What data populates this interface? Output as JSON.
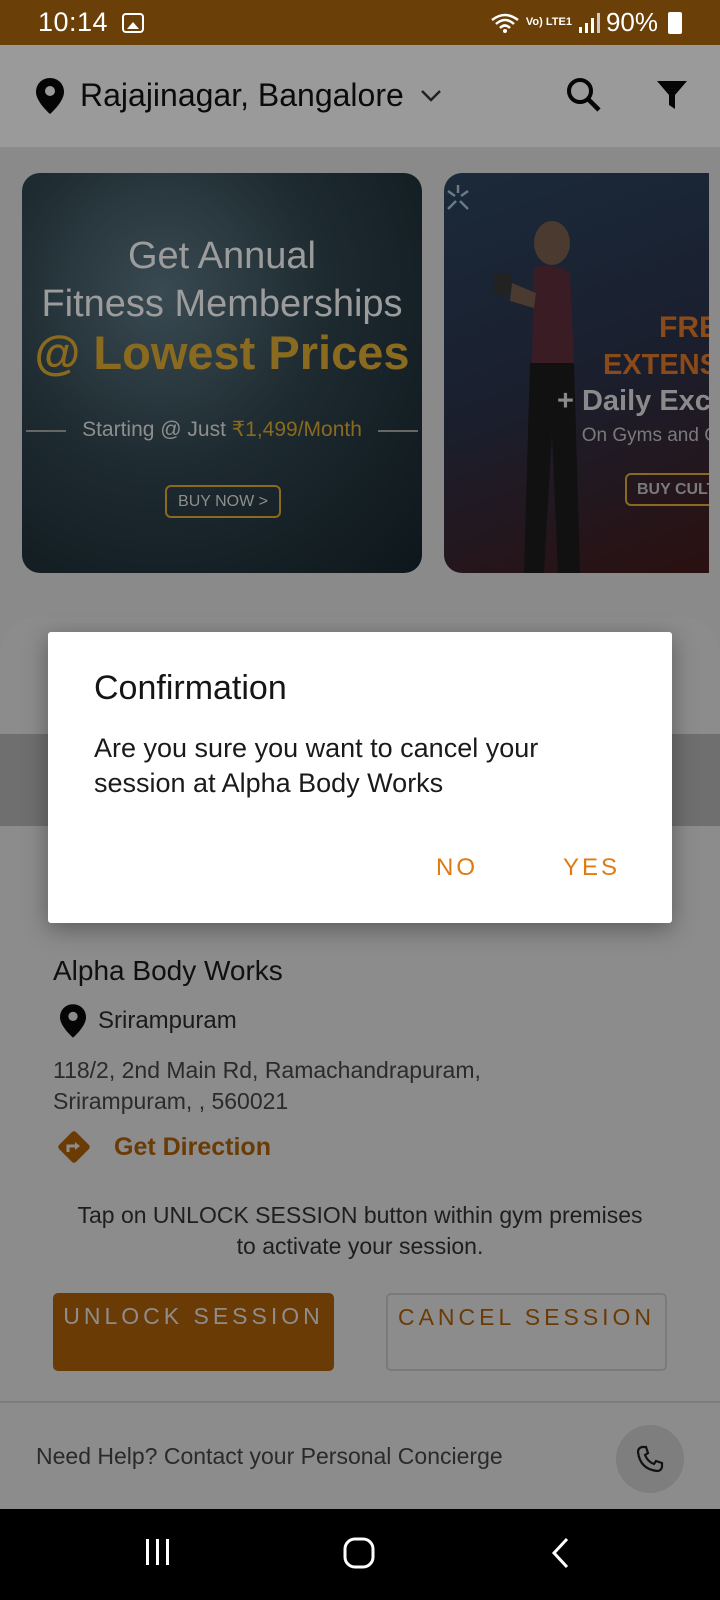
{
  "status_bar": {
    "time": "10:14",
    "network": "Vo) LTE1",
    "battery": "90%"
  },
  "header": {
    "location": "Rajajinagar, Bangalore"
  },
  "banners": [
    {
      "line1": "Get Annual",
      "line2": "Fitness Memberships",
      "line3": "@ Lowest Prices",
      "line4_prefix": "Starting @ Just ",
      "line4_price": "₹1,499/Month",
      "button": "BUY NOW >"
    },
    {
      "line1": "FRE",
      "line2": "EXTENS",
      "line3": "+ Daily Exci",
      "line4": "On Gyms and G",
      "button": "BUY CULT"
    }
  ],
  "gym": {
    "name": "Alpha Body Works",
    "area": "Srirampuram",
    "address": "118/2, 2nd Main Rd, Ramachandrapuram, Srirampuram, , 560021",
    "direction_label": "Get Direction",
    "hint": "Tap on UNLOCK SESSION button within gym premises to activate your session.",
    "unlock_label": "UNLOCK SESSION",
    "cancel_label": "CANCEL SESSION"
  },
  "help": {
    "text": "Need Help? Contact your Personal Concierge"
  },
  "dialog": {
    "title": "Confirmation",
    "message": "Are you sure you want to cancel your session at Alpha Body Works",
    "no_label": "NO",
    "yes_label": "YES"
  },
  "colors": {
    "accent": "#E07B10",
    "status_bar": "#6B3F08"
  }
}
